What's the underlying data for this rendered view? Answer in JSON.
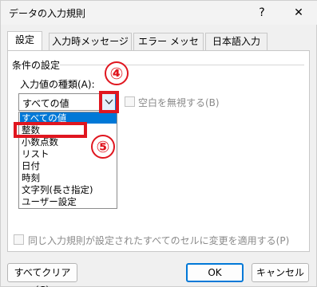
{
  "window": {
    "title": "データの入力規則",
    "help": "?",
    "close": "✕"
  },
  "tabs": [
    "設定",
    "入力時メッセージ",
    "エラー メッセージ",
    "日本語入力"
  ],
  "settings": {
    "group_label": "条件の設定",
    "type_label": "入力値の種類(A):",
    "type_value": "すべての値",
    "ignore_blank_label": "空白を無視する(B)",
    "options": [
      "すべての値",
      "整数",
      "小数点数",
      "リスト",
      "日付",
      "時刻",
      "文字列(長さ指定)",
      "ユーザー設定"
    ],
    "selected_option": "すべての値",
    "apply_all_label": "同じ入力規則が設定されたすべてのセルに変更を適用する(P)"
  },
  "annotations": {
    "marker_4": "④",
    "marker_5": "⑤",
    "color": "#e0161f"
  },
  "buttons": {
    "clear_all": "すべてクリア(C)",
    "ok": "OK",
    "cancel": "キャンセル"
  },
  "colors": {
    "accent": "#0078d7",
    "annotation": "#e0161f"
  }
}
